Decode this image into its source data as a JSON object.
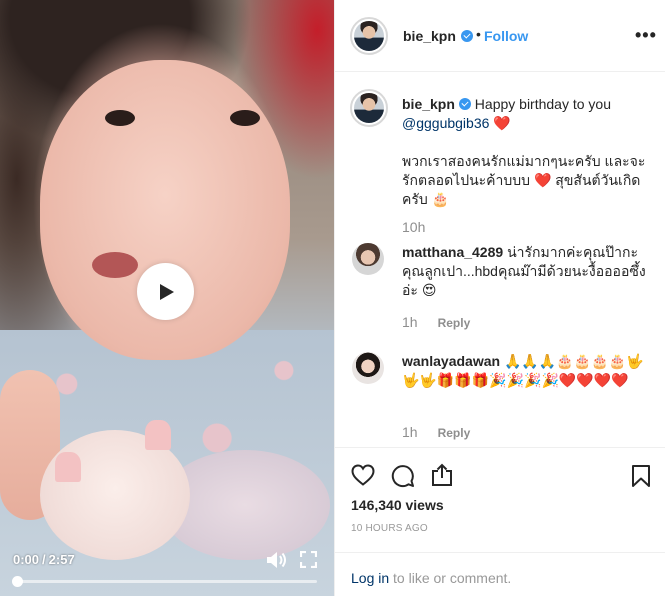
{
  "video": {
    "current_time": "0:00",
    "separator": "/",
    "duration": "2:57",
    "progress_fraction": 0.0
  },
  "header": {
    "username": "bie_kpn",
    "dot": "•",
    "follow_label": "Follow",
    "more_label": "•••"
  },
  "caption": {
    "username": "bie_kpn",
    "text_start": "Happy birthday to you",
    "mention": "@gggubgib36",
    "text_end": "❤️",
    "paragraph2": "พวกเราสองคนรักแม่มากๆนะครับ และจะรักตลอดไปนะค้าบบบ ❤️ สุขสันต์วันเกิดครับ 🎂",
    "time": "10h"
  },
  "comments": [
    {
      "username": "matthana_4289",
      "text": "น่ารักมากค่ะคุณป๊ากะคุณลูกเปา...hbdคุณม๊ามีด้วยนะงื้ออออซึ้งอ่ะ 😍",
      "time": "1h",
      "reply_label": "Reply"
    },
    {
      "username": "wanlayadawan",
      "text": "🙏🙏🙏🎂🎂🎂🎂🤟🤟🤟🎁🎁🎁🎉🎉🎉🎉❤️❤️❤️❤️",
      "time": "1h",
      "reply_label": "Reply"
    }
  ],
  "actions": {
    "views": "146,340 views",
    "posted_ago": "10 HOURS AGO"
  },
  "login": {
    "link": "Log in",
    "text": " to like or comment."
  },
  "colors": {
    "link_blue": "#3897f0",
    "mention_navy": "#003569",
    "muted": "#8e8e8e"
  },
  "icons": [
    "play-icon",
    "volume-icon",
    "fullscreen-icon",
    "verified-icon",
    "more-icon",
    "heart-icon",
    "comment-icon",
    "share-icon",
    "bookmark-icon"
  ]
}
